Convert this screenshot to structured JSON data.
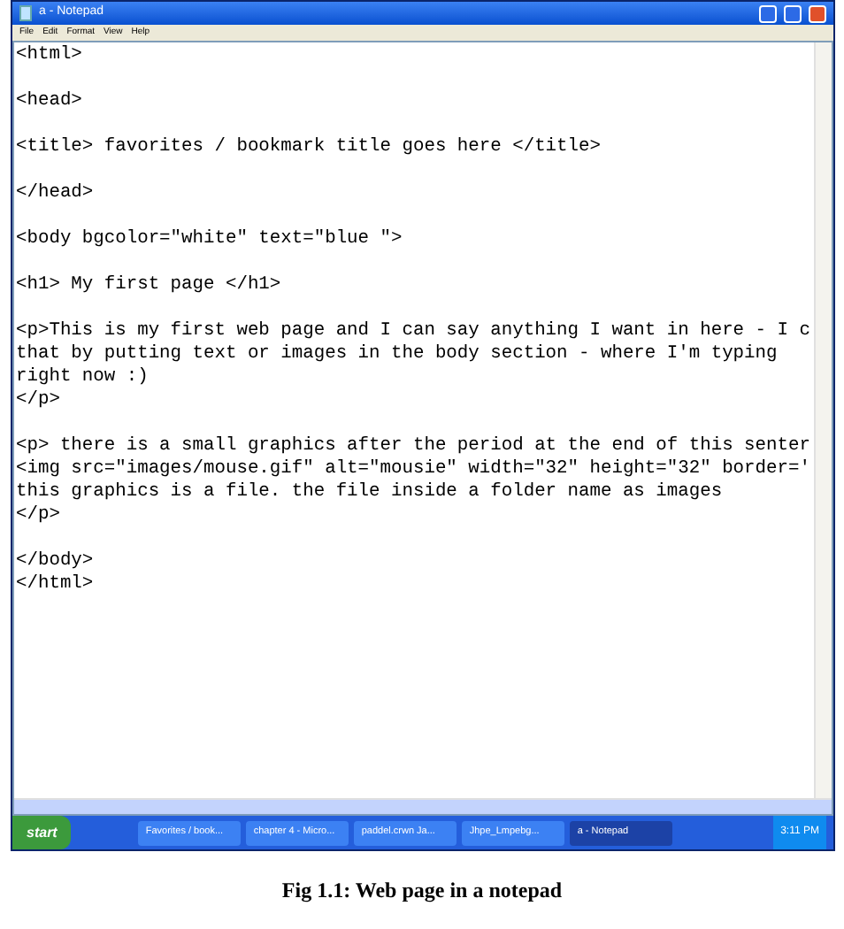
{
  "window": {
    "title": "a - Notepad"
  },
  "menu": [
    "File",
    "Edit",
    "Format",
    "View",
    "Help"
  ],
  "editor": {
    "blocks": [
      [
        "<html>"
      ],
      [
        "<head>"
      ],
      [
        "<title> favorites / bookmark title goes here </title>"
      ],
      [
        "</head>"
      ],
      [
        "<body bgcolor=\"white\" text=\"blue \">"
      ],
      [
        "<h1> My first page </h1>"
      ],
      [
        "<p>This is my first web page and I can say anything I want in here - I c",
        "that by putting text or images in the body section - where I'm typing",
        "right now :)",
        "</p>"
      ],
      [
        "<p> there is a small graphics after the period at the end of this senter",
        "<img src=\"images/mouse.gif\" alt=\"mousie\" width=\"32\" height=\"32\" border='",
        "this graphics is a file. the file inside a folder name as images",
        "</p>"
      ],
      [
        "</body>",
        "</html>"
      ]
    ]
  },
  "taskbar": {
    "start": "start",
    "tasks": [
      {
        "label": "Favorites / book...",
        "selected": false
      },
      {
        "label": "chapter 4 - Micro...",
        "selected": false
      },
      {
        "label": "paddel.crwn Ja...",
        "selected": false
      },
      {
        "label": "Jhpe_Lmpebg...",
        "selected": false
      },
      {
        "label": "a - Notepad",
        "selected": true
      }
    ],
    "clock": "3:11 PM"
  },
  "caption": "Fig 1.1: Web page in a notepad"
}
